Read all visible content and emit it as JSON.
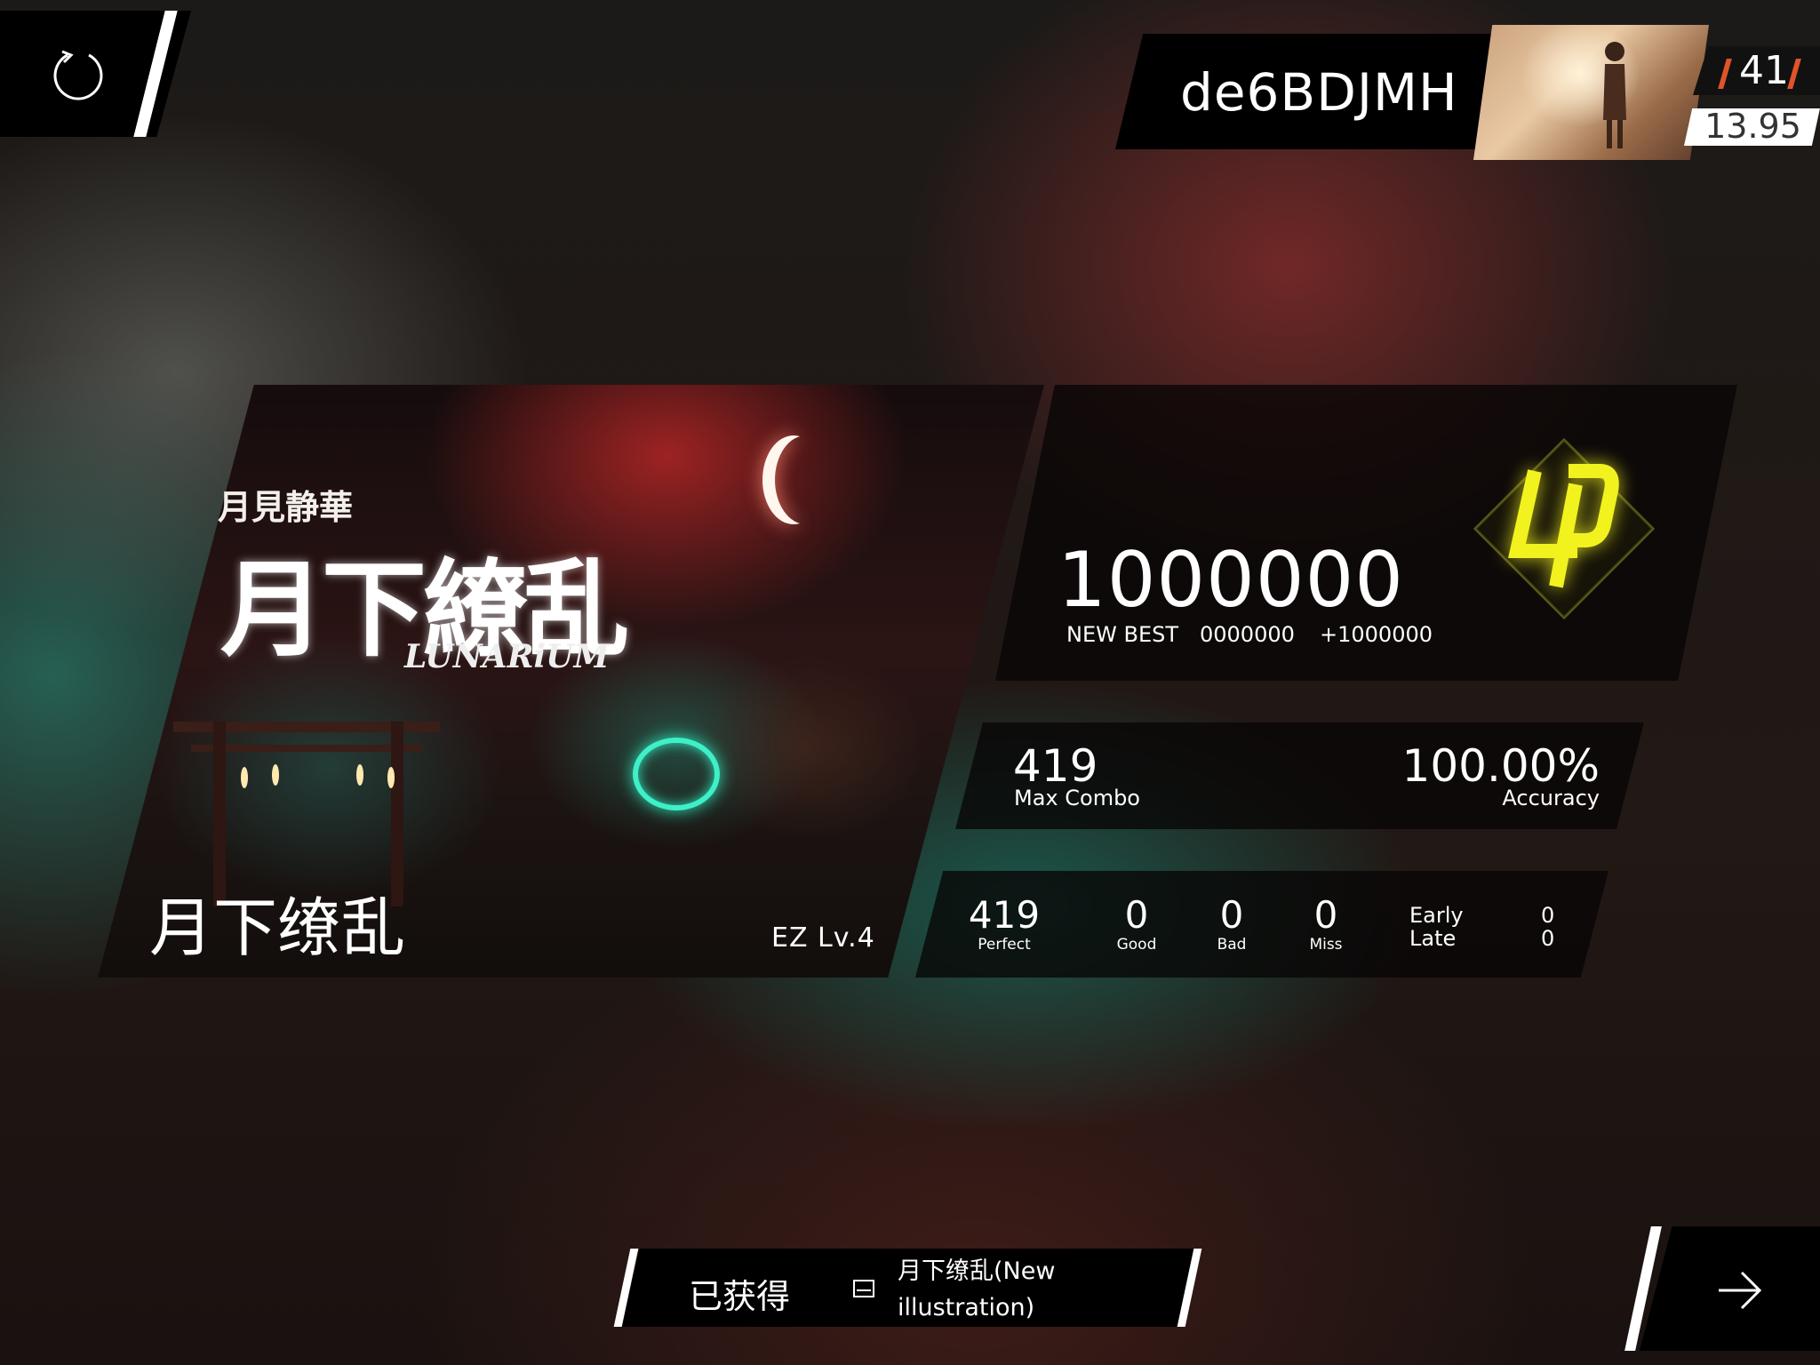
{
  "player": {
    "name": "de6BDJMH",
    "rank": "41",
    "ranking_score": "13.95"
  },
  "song": {
    "title": "月下缭乱",
    "difficulty": "EZ Lv.4",
    "logo_subtitle": "月見静華",
    "logo_title": "月下繚乱",
    "logo_english": "LUNARiUM"
  },
  "result": {
    "score": "1000000",
    "new_best_label": "NEW BEST",
    "previous_score": "0000000",
    "score_delta": "+1000000",
    "grade": "φ",
    "max_combo": "419",
    "max_combo_label": "Max Combo",
    "accuracy": "100.00%",
    "accuracy_label": "Accuracy",
    "judgements": {
      "perfect": "419",
      "perfect_label": "Perfect",
      "good": "0",
      "good_label": "Good",
      "bad": "0",
      "bad_label": "Bad",
      "miss": "0",
      "miss_label": "Miss",
      "early_label": "Early",
      "late_label": "Late",
      "early": "0",
      "late": "0"
    }
  },
  "reward": {
    "label": "已获得",
    "item": "月下缭乱(New illustration)",
    "icon": "illustration-icon"
  },
  "controls": {
    "retry_icon": "retry-icon",
    "next_icon": "arrow-right-icon"
  },
  "colors": {
    "grade": "#f2f21e",
    "rank_accent": "#e0532a",
    "ring": "#3ef0c8"
  }
}
